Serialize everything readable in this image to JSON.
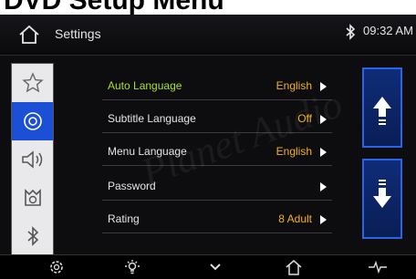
{
  "caption": "DVD Setup Menu",
  "header": {
    "title": "Settings",
    "clock": "09:32 AM",
    "home_icon": "home-icon",
    "status_icon": "bluetooth-icon"
  },
  "sidebar": {
    "items": [
      {
        "icon": "star-icon",
        "active": false
      },
      {
        "icon": "disc-icon",
        "active": true
      },
      {
        "icon": "speaker-icon",
        "active": false
      },
      {
        "icon": "mode-icon",
        "active": false
      },
      {
        "icon": "bluetooth-icon",
        "active": false
      }
    ]
  },
  "menu": {
    "rows": [
      {
        "label": "Auto Language",
        "value": "English",
        "highlight": true
      },
      {
        "label": "Subtitle Language",
        "value": "Off"
      },
      {
        "label": "Menu Language",
        "value": "English"
      },
      {
        "label": "Password",
        "value": ""
      },
      {
        "label": "Rating",
        "value": "8 Adult"
      }
    ]
  },
  "scroll": {
    "up_icon": "arrow-up-icon",
    "down_icon": "arrow-down-icon"
  },
  "watermark": "Planet Audio",
  "footer": {
    "items": [
      "gear-icon",
      "brightness-icon",
      "chevron-down-icon",
      "home-icon",
      "pulse-icon"
    ]
  },
  "colors": {
    "accent": "#1a4fd6",
    "value": "#f2b21b",
    "highlight": "#a6e12a"
  }
}
